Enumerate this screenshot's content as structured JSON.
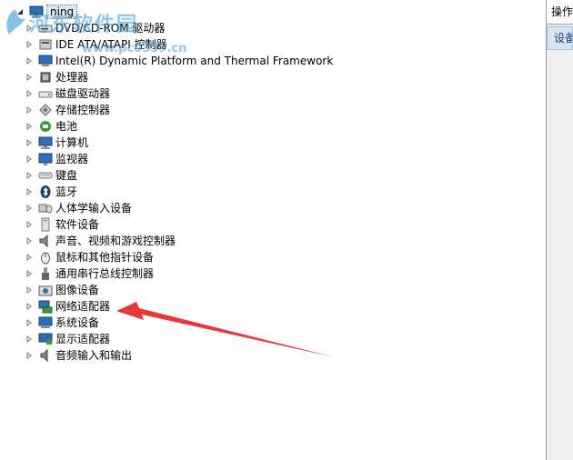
{
  "tree": {
    "root_label": "ning",
    "categories": [
      {
        "label": "DVD/CD-ROM 驱动器",
        "icon": "dvd-drive-icon"
      },
      {
        "label": "IDE ATA/ATAPI 控制器",
        "icon": "ide-controller-icon"
      },
      {
        "label": "Intel(R) Dynamic Platform and Thermal Framework",
        "icon": "computer-board-icon"
      },
      {
        "label": "处理器",
        "icon": "processor-icon"
      },
      {
        "label": "磁盘驱动器",
        "icon": "disk-drive-icon"
      },
      {
        "label": "存储控制器",
        "icon": "storage-controller-icon"
      },
      {
        "label": "电池",
        "icon": "battery-icon"
      },
      {
        "label": "计算机",
        "icon": "computer-icon"
      },
      {
        "label": "监视器",
        "icon": "monitor-icon"
      },
      {
        "label": "键盘",
        "icon": "keyboard-icon"
      },
      {
        "label": "蓝牙",
        "icon": "bluetooth-icon"
      },
      {
        "label": "人体学输入设备",
        "icon": "hid-icon"
      },
      {
        "label": "软件设备",
        "icon": "software-device-icon"
      },
      {
        "label": "声音、视频和游戏控制器",
        "icon": "speaker-icon"
      },
      {
        "label": "鼠标和其他指针设备",
        "icon": "mouse-icon"
      },
      {
        "label": "通用串行总线控制器",
        "icon": "usb-icon"
      },
      {
        "label": "图像设备",
        "icon": "camera-icon"
      },
      {
        "label": "网络适配器",
        "icon": "network-adapter-icon"
      },
      {
        "label": "系统设备",
        "icon": "system-device-icon"
      },
      {
        "label": "显示适配器",
        "icon": "display-adapter-icon"
      },
      {
        "label": "音频输入和输出",
        "icon": "audio-io-icon"
      }
    ]
  },
  "side_panel": {
    "header": "操作",
    "item": "设备"
  },
  "watermark": {
    "text": "河东软件园",
    "url": "www.pc0359.cn"
  },
  "annotation": {
    "arrow_color": "#e8373a"
  }
}
